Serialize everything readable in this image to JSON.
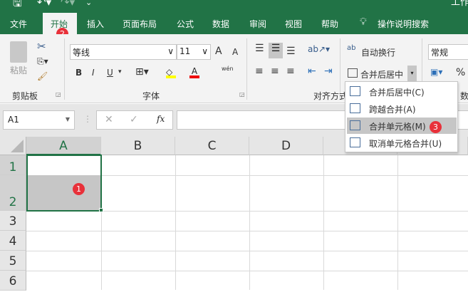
{
  "title_bar": {
    "title": "工作",
    "save_icon": "save-icon",
    "undo_icon": "undo-icon",
    "redo_icon": "redo-icon",
    "customize_icon": "chevron-down-icon"
  },
  "tabs": [
    "文件",
    "开始",
    "插入",
    "页面布局",
    "公式",
    "数据",
    "审阅",
    "视图",
    "帮助"
  ],
  "tell_me": "操作说明搜索",
  "ribbon": {
    "clipboard": {
      "paste": "粘贴",
      "label": "剪贴板"
    },
    "font": {
      "name": "等线",
      "size": "11",
      "bold": "B",
      "italic": "I",
      "underline": "U",
      "phonetic": "wén",
      "label": "字体",
      "grow": "A",
      "shrink": "A",
      "font_color": "A"
    },
    "alignment": {
      "wrap": "自动换行",
      "merge": "合并后居中",
      "label": "对齐方式"
    },
    "number": {
      "format": "常规",
      "percent": "%",
      "label": "数"
    }
  },
  "merge_menu": {
    "items": [
      {
        "label": "合并后居中(C)",
        "icon": "merge-center-icon"
      },
      {
        "label": "跨越合并(A)",
        "icon": "merge-across-icon"
      },
      {
        "label": "合并单元格(M)",
        "icon": "merge-cells-icon",
        "highlighted": true
      },
      {
        "label": "取消单元格合并(U)",
        "icon": "unmerge-icon"
      }
    ]
  },
  "formula_bar": {
    "name_box": "A1",
    "cancel": "✕",
    "enter": "✓",
    "fx": "fx",
    "value": ""
  },
  "columns": [
    "A",
    "B",
    "C",
    "D"
  ],
  "rows": [
    "1",
    "2",
    "3",
    "4",
    "5",
    "6"
  ],
  "selection": "A1:A2",
  "step_badges": [
    "1",
    "2",
    "3"
  ],
  "colors": {
    "excel_green": "#217346",
    "badge_red": "#e8313a",
    "selection_fill": "#c6c6c6"
  }
}
